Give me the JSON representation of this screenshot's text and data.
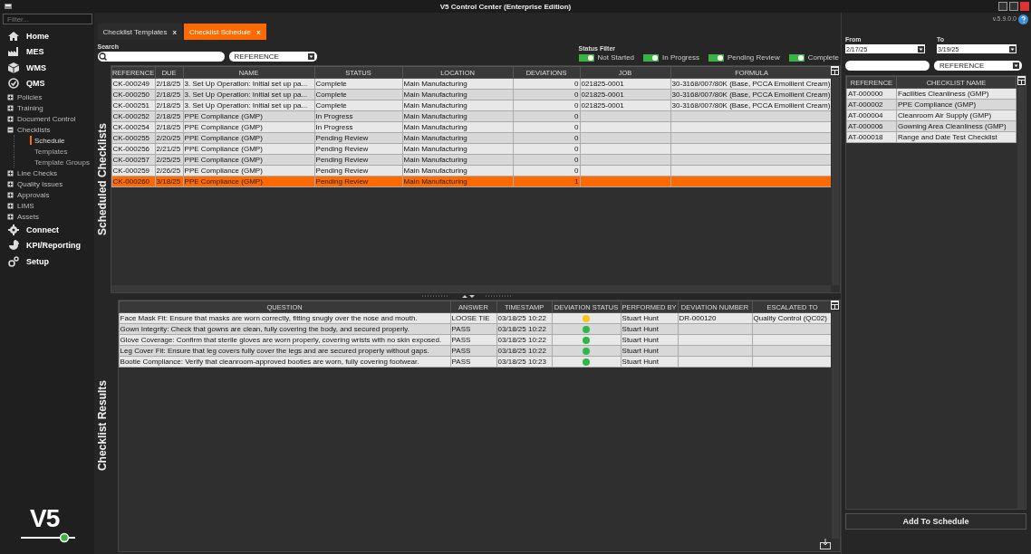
{
  "window": {
    "title": "V5 Control Center (Enterprise Edition)",
    "version": "v.5.9.0.0"
  },
  "sidebar": {
    "filter": {
      "placeholder": "Filter..."
    },
    "items": [
      {
        "label": "Home",
        "kind": "section"
      },
      {
        "label": "MES",
        "kind": "section"
      },
      {
        "label": "WMS",
        "kind": "section"
      },
      {
        "label": "QMS",
        "kind": "section"
      },
      {
        "label": "Policies",
        "kind": "node",
        "expanded": false
      },
      {
        "label": "Training",
        "kind": "node",
        "expanded": false
      },
      {
        "label": "Document Control",
        "kind": "node",
        "expanded": false
      },
      {
        "label": "Checklists",
        "kind": "node",
        "expanded": true,
        "children": [
          {
            "label": "Schedule",
            "selected": true
          },
          {
            "label": "Templates",
            "selected": false
          },
          {
            "label": "Template Groups",
            "selected": false
          }
        ]
      },
      {
        "label": "Line Checks",
        "kind": "node",
        "expanded": false
      },
      {
        "label": "Quality Issues",
        "kind": "node",
        "expanded": false
      },
      {
        "label": "Approvals",
        "kind": "node",
        "expanded": false
      },
      {
        "label": "LIMS",
        "kind": "node",
        "expanded": false
      },
      {
        "label": "Assets",
        "kind": "node",
        "expanded": false
      },
      {
        "label": "Connect",
        "kind": "section"
      },
      {
        "label": "KPI/Reporting",
        "kind": "section"
      },
      {
        "label": "Setup",
        "kind": "section"
      }
    ],
    "logo": "V5"
  },
  "tabs": [
    {
      "label": "Checklist Templates",
      "close": "x",
      "selected": false
    },
    {
      "label": "Checklist Schedule",
      "close": "x",
      "selected": true
    }
  ],
  "search": {
    "label": "Search",
    "dropdown": "REFERENCE"
  },
  "status_filter": {
    "label": "Status Filter",
    "toggles": [
      {
        "label": "Not Started",
        "on": true
      },
      {
        "label": "In Progress",
        "on": true
      },
      {
        "label": "Pending Review",
        "on": true
      },
      {
        "label": "Complete",
        "on": true
      }
    ]
  },
  "schedule_table": {
    "title": "Scheduled Checklists",
    "columns": [
      "REFERENCE",
      "DUE",
      "NAME",
      "STATUS",
      "LOCATION",
      "DEVIATIONS",
      "JOB",
      "FORMULA"
    ],
    "rows": [
      {
        "cells": [
          "CK-000249",
          "2/18/25",
          "3. Set Up Operation: Initial set up pa...",
          "Complete",
          "Main Manufacturing",
          "0",
          "021825-0001",
          "30-3168/007/80K (Base, PCCA Emollient Cream)"
        ],
        "selected": false
      },
      {
        "cells": [
          "CK-000250",
          "2/18/25",
          "3. Set Up Operation: Initial set up pa...",
          "Complete",
          "Main Manufacturing",
          "0",
          "021825-0001",
          "30-3168/007/80K (Base, PCCA Emollient Cream)"
        ],
        "selected": false
      },
      {
        "cells": [
          "CK-000251",
          "2/18/25",
          "3. Set Up Operation: Initial set up pa...",
          "Complete",
          "Main Manufacturing",
          "0",
          "021825-0001",
          "30-3168/007/80K (Base, PCCA Emollient Cream)"
        ],
        "selected": false
      },
      {
        "cells": [
          "CK-000252",
          "2/18/25",
          "PPE Compliance (GMP)",
          "In Progress",
          "Main Manufacturing",
          "0",
          "",
          ""
        ],
        "selected": false
      },
      {
        "cells": [
          "CK-000254",
          "2/18/25",
          "PPE Compliance (GMP)",
          "In Progress",
          "Main Manufacturing",
          "0",
          "",
          ""
        ],
        "selected": false
      },
      {
        "cells": [
          "CK-000255",
          "2/20/25",
          "PPE Compliance (GMP)",
          "Pending Review",
          "Main Manufacturing",
          "0",
          "",
          ""
        ],
        "selected": false
      },
      {
        "cells": [
          "CK-000256",
          "2/21/25",
          "PPE Compliance (GMP)",
          "Pending Review",
          "Main Manufacturing",
          "0",
          "",
          ""
        ],
        "selected": false
      },
      {
        "cells": [
          "CK-000257",
          "2/25/25",
          "PPE Compliance (GMP)",
          "Pending Review",
          "Main Manufacturing",
          "0",
          "",
          ""
        ],
        "selected": false
      },
      {
        "cells": [
          "CK-000259",
          "2/26/25",
          "PPE Compliance (GMP)",
          "Pending Review",
          "Main Manufacturing",
          "0",
          "",
          ""
        ],
        "selected": false
      },
      {
        "cells": [
          "CK-000260",
          "3/18/25",
          "PPE Compliance (GMP)",
          "Pending Review",
          "Main Manufacturing",
          "1",
          "",
          ""
        ],
        "selected": true
      }
    ]
  },
  "results_table": {
    "title": "Checklist Results",
    "columns": [
      "QUESTION",
      "ANSWER",
      "TIMESTAMP",
      "DEVIATION STATUS",
      "PERFORMED BY",
      "DEVIATION NUMBER",
      "ESCALATED TO"
    ],
    "rows": [
      {
        "question": "Face Mask Fit: Ensure that masks are worn correctly, fitting snugly over the nose and mouth.",
        "answer": "LOOSE TIE",
        "timestamp": "03/18/25 10:22",
        "color": "#f5c518",
        "performed_by": "Stuart Hunt",
        "deviation_number": "DR-000120",
        "escalated_to": "Quality Control (QC02)"
      },
      {
        "question": "Gown Integrity: Check that gowns are clean, fully covering the body, and secured properly.",
        "answer": "PASS",
        "timestamp": "03/18/25 10:22",
        "color": "#2db84a",
        "performed_by": "Stuart Hunt"
      },
      {
        "question": "Glove Coverage: Confirm that sterile gloves are worn properly, covering wrists with no skin exposed.",
        "answer": "PASS",
        "timestamp": "03/18/25 10:22",
        "color": "#2db84a",
        "performed_by": "Stuart Hunt"
      },
      {
        "question": "Leg Cover Fit: Ensure that leg covers fully cover the legs and are secured properly without gaps.",
        "answer": "PASS",
        "timestamp": "03/18/25 10:22",
        "color": "#2db84a",
        "performed_by": "Stuart Hunt"
      },
      {
        "question": "Bootie Compliance: Verify that cleanroom-approved booties are worn, fully covering footwear.",
        "answer": "PASS",
        "timestamp": "03/18/25 10:23",
        "color": "#2db84a",
        "performed_by": "Stuart Hunt"
      }
    ]
  },
  "date_range": {
    "from": {
      "label": "From",
      "value": "2/17/25"
    },
    "to": {
      "label": "To",
      "value": "3/19/25"
    }
  },
  "template_search": {
    "dropdown": "REFERENCE"
  },
  "templates_table": {
    "columns": [
      "REFERENCE",
      "CHECKLIST NAME"
    ],
    "rows": [
      {
        "cells": [
          "AT-000000",
          "Facilities Cleanliness (GMP)"
        ]
      },
      {
        "cells": [
          "AT-000002",
          "PPE Compliance (GMP)"
        ]
      },
      {
        "cells": [
          "AT-000004",
          "Cleanroom Air Supply (GMP)"
        ]
      },
      {
        "cells": [
          "AT-000006",
          "Gowning Area Cleanliness (GMP)"
        ]
      },
      {
        "cells": [
          "AT-000018",
          "Range and Date Test Checklist"
        ]
      }
    ]
  },
  "add_button": "Add To Schedule"
}
